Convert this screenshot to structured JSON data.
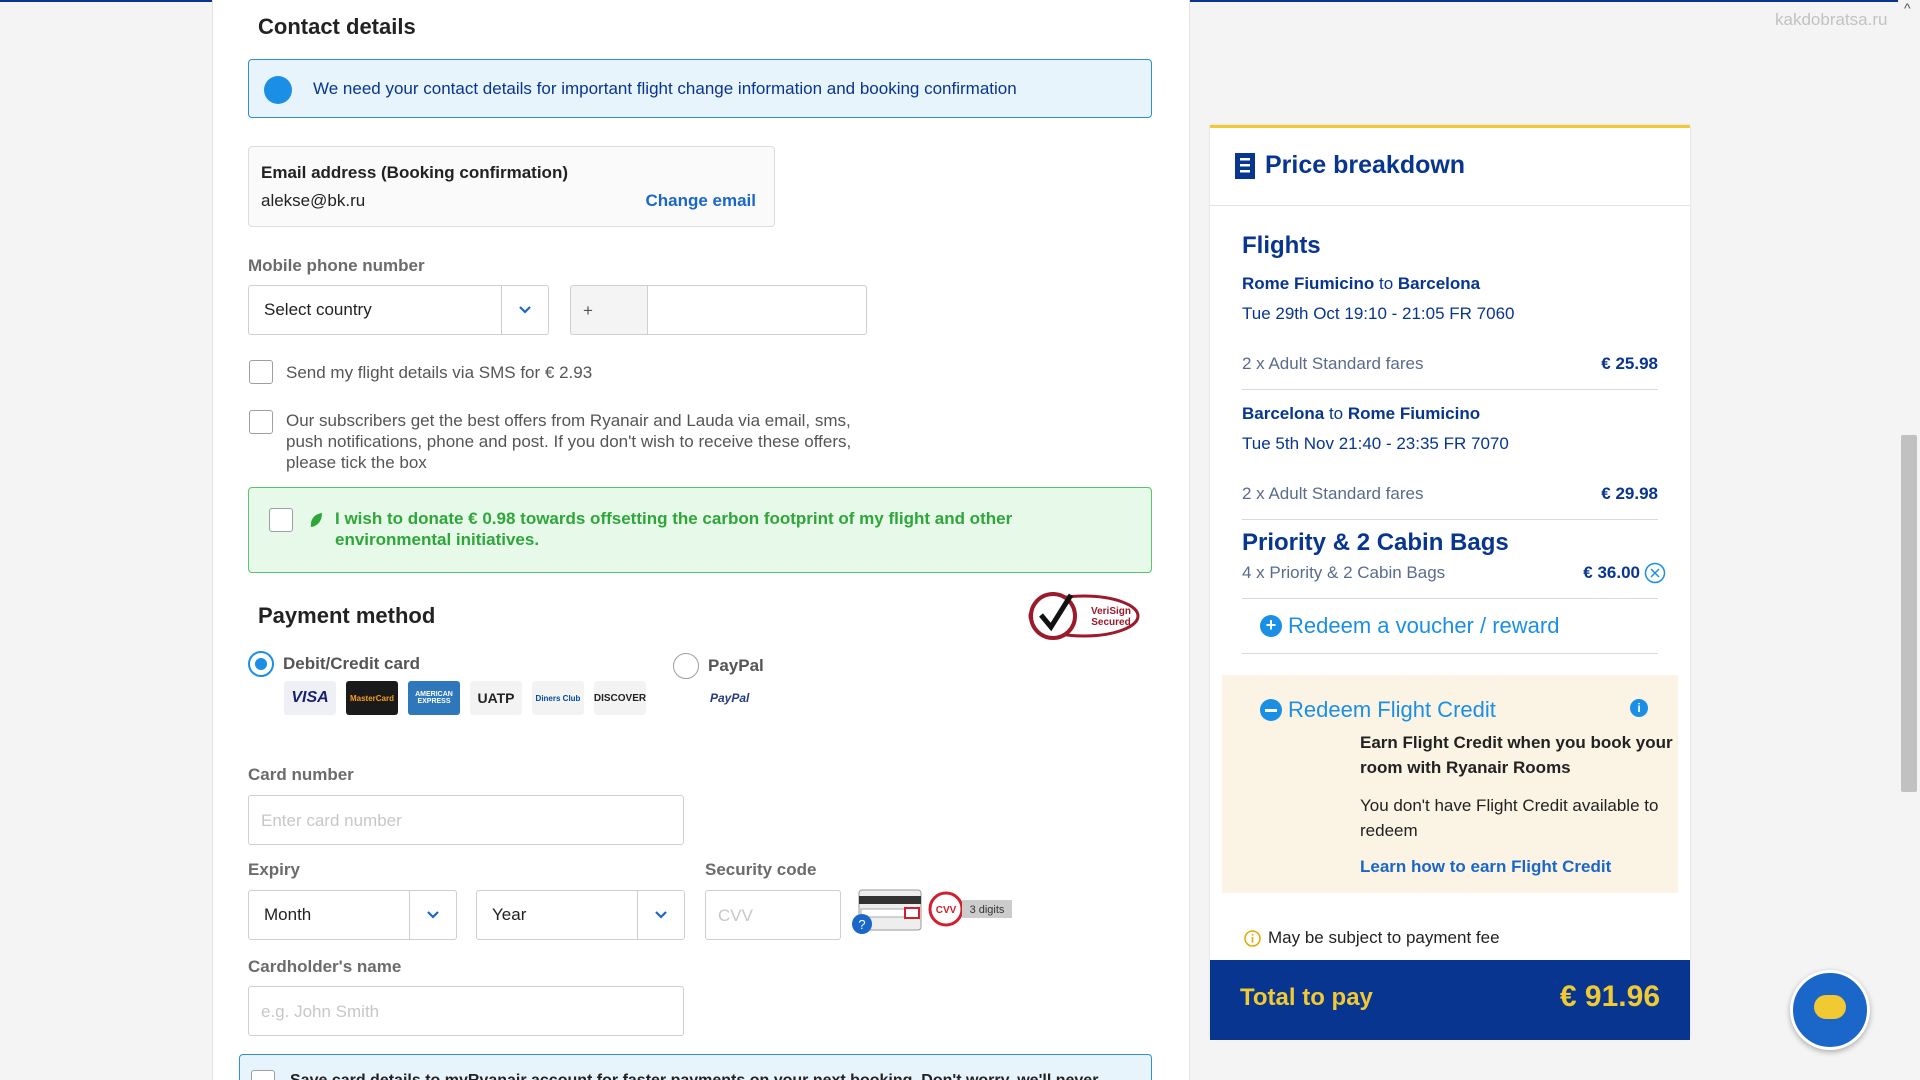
{
  "watermark": "kakdobratsa.ru",
  "contact": {
    "title": "Contact details",
    "info_text": "We need your contact details for important flight change information and booking confirmation",
    "email_label": "Email address (Booking confirmation)",
    "email_value": "alekse@bk.ru",
    "change_email": "Change email",
    "phone_label": "Mobile phone number",
    "country_select": "Select country",
    "phone_prefix": "+",
    "sms_option": "Send my flight details via SMS for € 2.93",
    "subscribe_line1": "Our subscribers get the best offers from Ryanair and Lauda via email, sms,",
    "subscribe_line2": "push notifications, phone and post. If you don't wish to receive these offers,",
    "subscribe_line3": "please tick the box",
    "donate_line1": "I wish to donate € 0.98 towards offsetting the carbon footprint of my flight and other",
    "donate_line2": "environmental initiatives."
  },
  "payment": {
    "title": "Payment method",
    "verisign_line1": "VeriSign",
    "verisign_line2": "Secured",
    "card_option": "Debit/Credit card",
    "paypal_option": "PayPal",
    "paypal_logo": "PayPal",
    "card_logos": [
      "VISA",
      "MasterCard",
      "AMERICAN EXPRESS",
      "UATP",
      "Diners Club",
      "DISCOVER"
    ],
    "card_number_label": "Card number",
    "card_number_placeholder": "Enter card number",
    "expiry_label": "Expiry",
    "month_select": "Month",
    "year_select": "Year",
    "security_label": "Security code",
    "cvv_placeholder": "CVV",
    "cvv_badge": "CVV",
    "cvv_hint": "3 digits",
    "cardholder_label": "Cardholder's name",
    "cardholder_placeholder": "e.g. John Smith",
    "save_card_text": "Save card details to myRyanair account for faster payments on your next booking. Don't worry, we'll never"
  },
  "price": {
    "title": "Price breakdown",
    "flights_heading": "Flights",
    "leg1": {
      "from": "Rome Fiumicino",
      "to_word": "to",
      "to": "Barcelona",
      "datetime": "Tue 29th Oct 19:10 - 21:05 FR 7060",
      "fares": "2 x Adult Standard fares",
      "amount": "€ 25.98"
    },
    "leg2": {
      "from": "Barcelona",
      "to_word": "to",
      "to": "Rome Fiumicino",
      "datetime": "Tue 5th Nov 21:40 - 23:35 FR 7070",
      "fares": "2 x Adult Standard fares",
      "amount": "€ 29.98"
    },
    "bags_heading": "Priority & 2 Cabin Bags",
    "bags_line": "4 x Priority & 2 Cabin Bags",
    "bags_amount": "€ 36.00",
    "voucher": "Redeem a voucher / reward",
    "credit_title": "Redeem Flight Credit",
    "credit_line1": "Earn Flight Credit when you book your",
    "credit_line2": "room with Ryanair Rooms",
    "credit_none1": "You don't have Flight Credit available to",
    "credit_none2": "redeem",
    "credit_link": "Learn how to earn Flight Credit",
    "fee_note": "May be subject to payment fee",
    "total_label": "Total to pay",
    "total_value": "€ 91.96"
  },
  "colors": {
    "brand_blue": "#073590",
    "accent_yellow": "#f1c933",
    "link_blue": "#1b8fe6",
    "green": "#2fa63a"
  }
}
